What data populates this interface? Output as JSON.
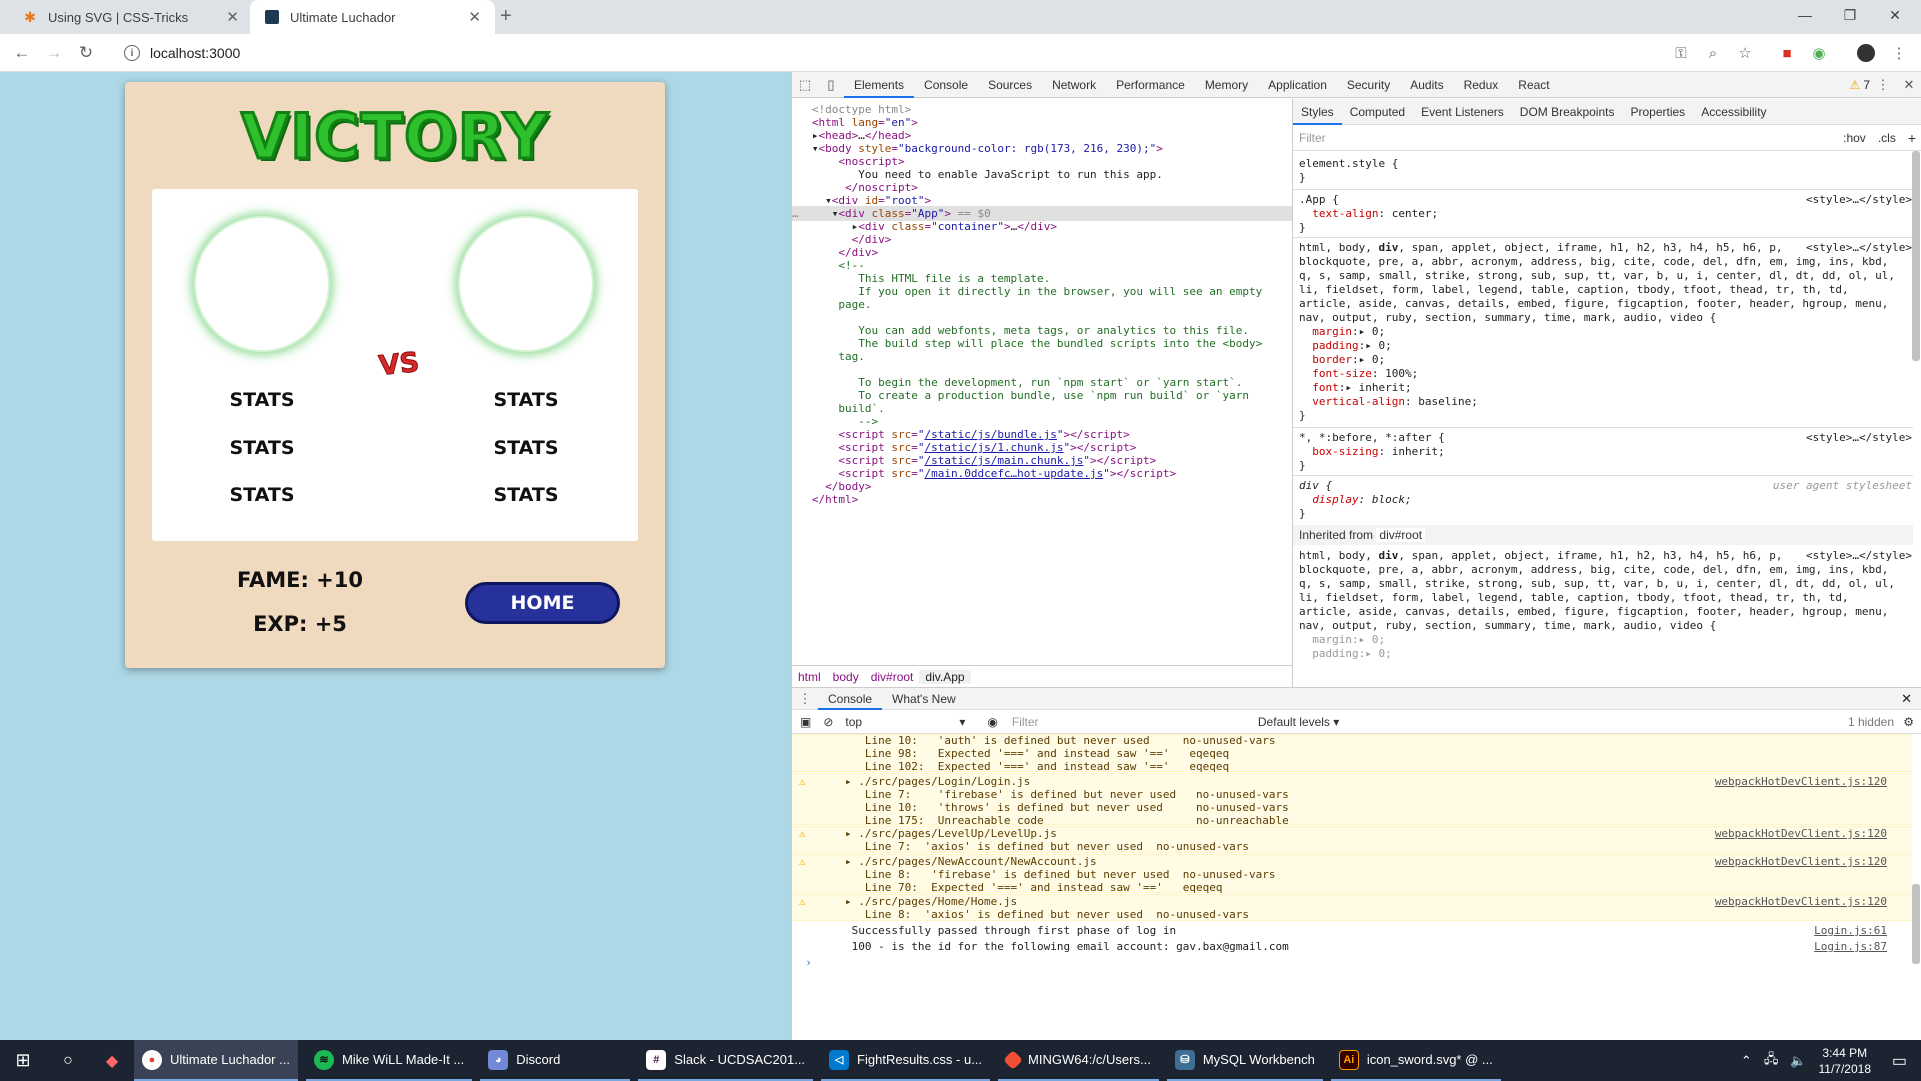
{
  "browser": {
    "tabs": [
      {
        "title": "Using SVG | CSS-Tricks",
        "icon": "css-tricks-star-icon",
        "active": false
      },
      {
        "title": "Ultimate Luchador",
        "icon": "react-app-icon",
        "active": true
      }
    ],
    "url": "localhost:3000"
  },
  "page": {
    "title": "VICTORY",
    "vs_label": "VS",
    "left_stats": [
      "STATS",
      "STATS",
      "STATS"
    ],
    "right_stats": [
      "STATS",
      "STATS",
      "STATS"
    ],
    "fame": "FAME: +10",
    "exp": "EXP: +5",
    "home_button": "HOME",
    "colors": {
      "background": "#add8e6",
      "card": "#efd9bf",
      "title": "#2fc12d",
      "vs": "#d72929",
      "button": "#27319b"
    }
  },
  "devtools": {
    "main_tabs": [
      "Elements",
      "Console",
      "Sources",
      "Network",
      "Performance",
      "Memory",
      "Application",
      "Security",
      "Audits",
      "Redux",
      "React"
    ],
    "warning_count": "7",
    "breadcrumbs": [
      "html",
      "body",
      "div#root",
      "div.App"
    ],
    "styles_tabs": [
      "Styles",
      "Computed",
      "Event Listeners",
      "DOM Breakpoints",
      "Properties",
      "Accessibility"
    ],
    "styles_filter_placeholder": "Filter",
    "styles_hov": ":hov",
    "styles_cls": ".cls",
    "inherited_label": "Inherited from",
    "inherited_from": "div#root",
    "drawer_tabs": [
      "Console",
      "What's New"
    ],
    "console_context": "top",
    "console_filter_placeholder": "Filter",
    "console_levels": "Default levels",
    "console_hidden": "1 hidden"
  },
  "taskbar": {
    "apps": [
      {
        "label": "Ultimate Luchador ...",
        "icon": "chrome-icon",
        "active": true
      },
      {
        "label": "Mike WiLL Made-It ...",
        "icon": "spotify-icon",
        "active": false
      },
      {
        "label": "Discord",
        "icon": "discord-icon",
        "active": false
      },
      {
        "label": "Slack - UCDSAC201...",
        "icon": "slack-icon",
        "active": false
      },
      {
        "label": "FightResults.css - u...",
        "icon": "vscode-icon",
        "active": false
      },
      {
        "label": "MINGW64:/c/Users...",
        "icon": "git-bash-icon",
        "active": false
      },
      {
        "label": "MySQL Workbench",
        "icon": "mysql-workbench-icon",
        "active": false
      },
      {
        "label": "icon_sword.svg* @ ...",
        "icon": "illustrator-icon",
        "active": false
      }
    ],
    "time": "3:44 PM",
    "date": "11/7/2018"
  }
}
